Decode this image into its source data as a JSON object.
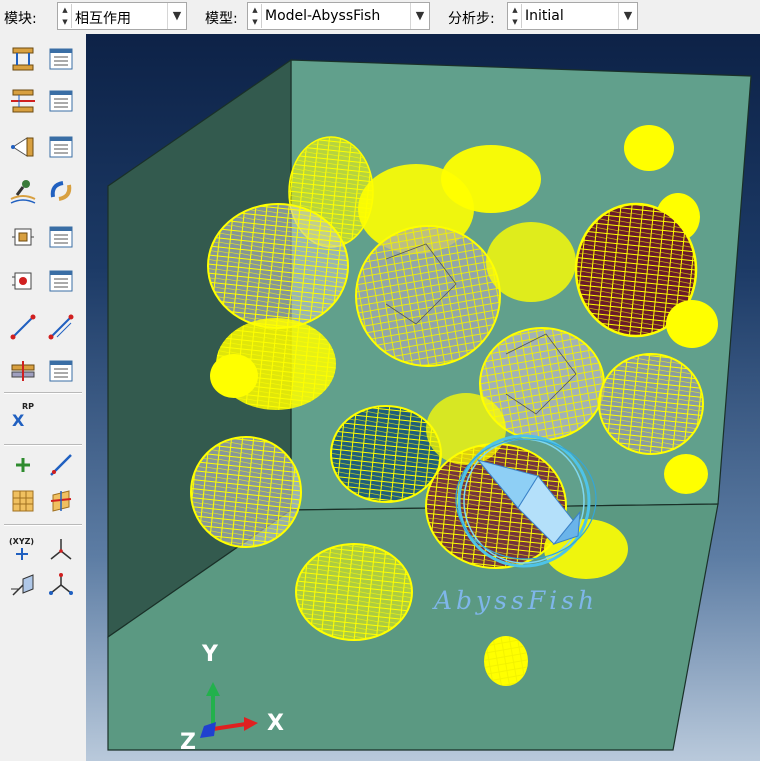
{
  "toolbar": {
    "module_label": "模块:",
    "module_value": "相互作用",
    "model_label": "模型:",
    "model_value": "Model-AbyssFish",
    "step_label": "分析步:",
    "step_value": "Initial"
  },
  "toolbox": {
    "tools": [
      "create-interaction-icon",
      "interaction-manager-icon",
      "create-property-icon",
      "property-manager-icon",
      "create-constraint-icon",
      "constraint-manager-icon",
      "find-contact-pairs-icon",
      "contact-controls-icon",
      "create-connector-section-icon",
      "connector-section-manager-icon",
      "create-connector-assign-icon",
      "connector-assign-manager-icon",
      "create-wire-icon",
      "create-wire-alt-icon",
      "create-fastener-icon",
      "fastener-manager-icon",
      "reference-point-icon",
      "create-datum-point-icon",
      "create-datum-axis-icon",
      "create-partition-icon",
      "partition-cell-icon",
      "create-datum-csys-icon",
      "datum-csys-3d-icon",
      "query-distance-icon",
      "query-angle-icon"
    ],
    "rp_label": "RP",
    "xyz_label": "(XYZ)"
  },
  "viewport": {
    "triad": {
      "y": "Y",
      "x": "X",
      "z": "Z"
    },
    "watermark": "AbyssFish"
  },
  "colors": {
    "toolbar_bg": "#f0f0f0",
    "box_face": "#61a08c",
    "mesh_yellow": "#ffff00",
    "viewport_top": "#0d2247",
    "viewport_bottom": "#b9c9db",
    "watermark": "#7fb6ea"
  }
}
